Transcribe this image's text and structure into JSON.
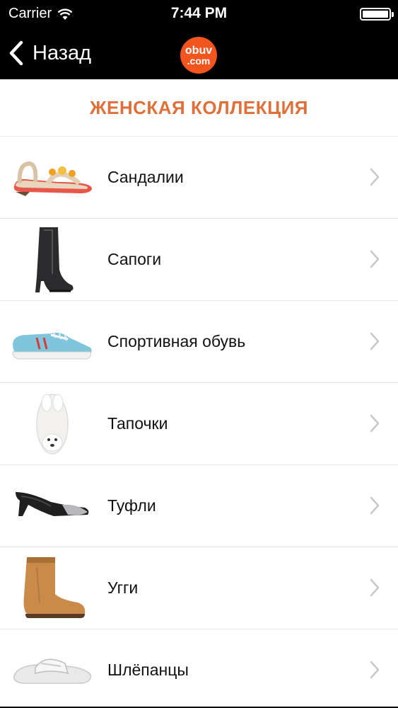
{
  "status_bar": {
    "carrier": "Carrier",
    "time": "7:44 PM"
  },
  "nav": {
    "back_label": "Назад",
    "logo": {
      "top": "obuv",
      "bottom": ".com",
      "color": "#f2551e"
    }
  },
  "page": {
    "title": "ЖЕНСКАЯ КОЛЛЕКЦИЯ",
    "title_color": "#e0703a"
  },
  "categories": [
    {
      "label": "Сандалии",
      "icon": "sandal-icon"
    },
    {
      "label": "Сапоги",
      "icon": "boot-icon"
    },
    {
      "label": "Спортивная обувь",
      "icon": "sneaker-icon"
    },
    {
      "label": "Тапочки",
      "icon": "slipper-icon"
    },
    {
      "label": "Туфли",
      "icon": "pump-icon"
    },
    {
      "label": "Угги",
      "icon": "ugg-icon"
    },
    {
      "label": "Шлёпанцы",
      "icon": "slide-icon"
    }
  ]
}
